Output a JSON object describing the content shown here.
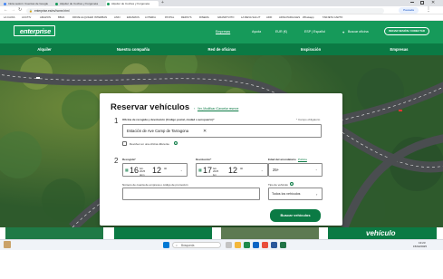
{
  "browser": {
    "tabs": [
      {
        "label": "Inicia sesión: Cuentas de Google",
        "color": "#e8eaed",
        "fav": "#4285f4"
      },
      {
        "label": "Alquiler de Coches y Furgoneta",
        "color": "#e8eaed",
        "fav": "#169a5a"
      },
      {
        "label": "Alquiler de Coches y Furgoneta",
        "color": "#ffffff",
        "fav": "#169a5a"
      }
    ],
    "new_tab": "+",
    "url": "enterprise.es/es/home.html",
    "profile_label": "Pausada",
    "bookmarks": [
      "LA CAIXA",
      "ACCTIV",
      "AMAZON",
      "BBVA",
      "DRIVE ALQUILER",
      "INTERBAN",
      "ANKI",
      "ERASMUS",
      "LOTERIA",
      "PAYPAL",
      "REDSYS",
      "RISEMA",
      "GRANDTUITO",
      "LA MEVA SALUT",
      "ADIF",
      "ADNA PARAULES",
      "Whatsapp",
      "TARJETA CARTO"
    ]
  },
  "header": {
    "logo": "enterprise",
    "links": [
      "Empresas",
      "Ayuda",
      "EUR (€)",
      "ESP | Español",
      "Buscar oficina"
    ],
    "signin_label": "INICIAR SESIÓN / CONECTAR"
  },
  "nav": {
    "items": [
      "Alquiler",
      "Nuestra compañía",
      "Red de oficinas",
      "Inspiración",
      "Empresas"
    ]
  },
  "booking": {
    "title": "Reservar vehículos",
    "modify_link": "Ver, Modificar /Cancelar reserve",
    "step1": "1",
    "step2": "2",
    "pickup_label": "Oficina de recogida y devolución (Código postal, ciudad o aeropuerto)*",
    "required_note": "* Campo obligatorio",
    "pickup_value": "Estación de Ave Camp de Tarragona",
    "return_different_label": "Devolver en una oficina diferente",
    "pickup_date_label": "Recogida*",
    "pickup_day": "16",
    "pickup_month": "feb.",
    "pickup_year": "2025",
    "pickup_weekday": "dom",
    "pickup_hour": "12",
    "pickup_min": "00",
    "return_date_label": "Devolución*",
    "return_day": "17",
    "return_month": "feb.",
    "return_year": "2025",
    "return_weekday": "lun",
    "return_hour": "12",
    "return_min": "00",
    "age_label": "Edad del arrendatario",
    "age_policy_link": "Política",
    "age_value": "25+",
    "promo_label": "Número de cuenta de empresa o código de promoción",
    "vehicle_type_label": "Tipo de vehículo",
    "vehicle_type_value": "Todos los vehículos",
    "search_button": "Buscar vehículos"
  },
  "taskbar": {
    "search_placeholder": "Búsqueda",
    "time": "13:23",
    "date": "15/02/2025",
    "promo_word": "vehículo"
  }
}
